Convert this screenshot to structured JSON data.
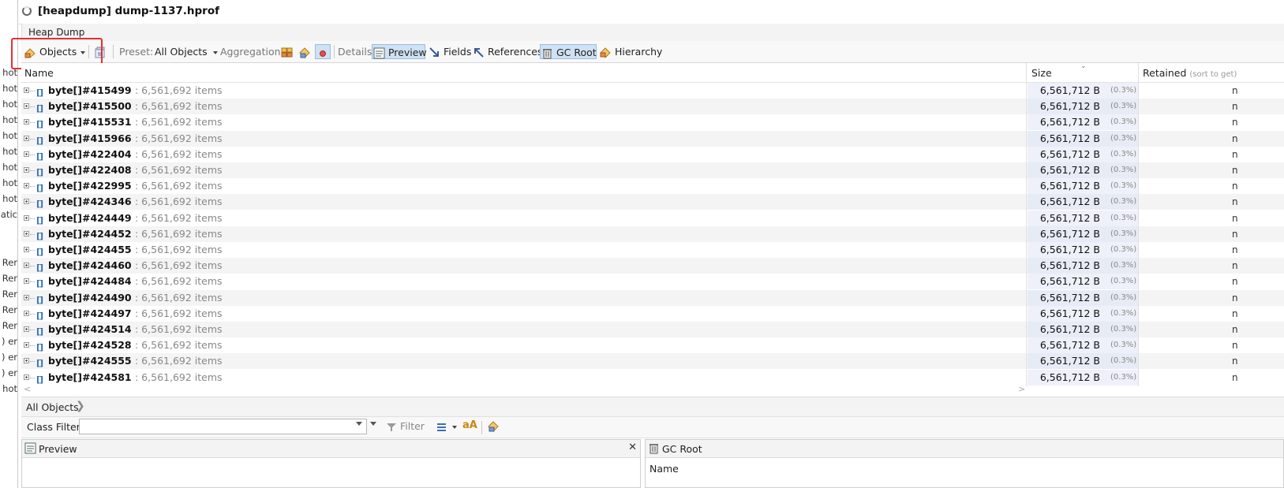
{
  "left_strip": [
    "hot",
    "hot",
    "hot",
    "hot",
    "hot",
    "hot",
    "hot",
    "hot",
    "hot",
    "atic",
    "",
    "",
    "",
    "Rer",
    "Rer",
    "Rer",
    "Rer",
    "Rer",
    "er (",
    "er (",
    "er (",
    "hot"
  ],
  "window": {
    "title": "[heapdump] dump-1137.hprof",
    "tab": "Heap Dump"
  },
  "toolbar": {
    "objects_label": "Objects",
    "preset_label": "Preset:",
    "preset_value": "All Objects",
    "aggregation_label": "Aggregation:",
    "details_label": "Details:",
    "preview_label": "Preview",
    "fields_label": "Fields",
    "references_label": "References",
    "gcroot_label": "GC Root",
    "hierarchy_label": "Hierarchy"
  },
  "table": {
    "col_name": "Name",
    "col_size": "Size",
    "col_retained": "Retained",
    "col_retained_hint": "(sort to get)",
    "rows": [
      {
        "name": "byte[]#415499",
        "items": ": 6,561,692 items",
        "size": "6,561,712 B",
        "pct": "(0.3%)",
        "ret": "n"
      },
      {
        "name": "byte[]#415500",
        "items": ": 6,561,692 items",
        "size": "6,561,712 B",
        "pct": "(0.3%)",
        "ret": "n"
      },
      {
        "name": "byte[]#415531",
        "items": ": 6,561,692 items",
        "size": "6,561,712 B",
        "pct": "(0.3%)",
        "ret": "n"
      },
      {
        "name": "byte[]#415966",
        "items": ": 6,561,692 items",
        "size": "6,561,712 B",
        "pct": "(0.3%)",
        "ret": "n"
      },
      {
        "name": "byte[]#422404",
        "items": ": 6,561,692 items",
        "size": "6,561,712 B",
        "pct": "(0.3%)",
        "ret": "n"
      },
      {
        "name": "byte[]#422408",
        "items": ": 6,561,692 items",
        "size": "6,561,712 B",
        "pct": "(0.3%)",
        "ret": "n"
      },
      {
        "name": "byte[]#422995",
        "items": ": 6,561,692 items",
        "size": "6,561,712 B",
        "pct": "(0.3%)",
        "ret": "n"
      },
      {
        "name": "byte[]#424346",
        "items": ": 6,561,692 items",
        "size": "6,561,712 B",
        "pct": "(0.3%)",
        "ret": "n"
      },
      {
        "name": "byte[]#424449",
        "items": ": 6,561,692 items",
        "size": "6,561,712 B",
        "pct": "(0.3%)",
        "ret": "n"
      },
      {
        "name": "byte[]#424452",
        "items": ": 6,561,692 items",
        "size": "6,561,712 B",
        "pct": "(0.3%)",
        "ret": "n"
      },
      {
        "name": "byte[]#424455",
        "items": ": 6,561,692 items",
        "size": "6,561,712 B",
        "pct": "(0.3%)",
        "ret": "n"
      },
      {
        "name": "byte[]#424460",
        "items": ": 6,561,692 items",
        "size": "6,561,712 B",
        "pct": "(0.3%)",
        "ret": "n"
      },
      {
        "name": "byte[]#424484",
        "items": ": 6,561,692 items",
        "size": "6,561,712 B",
        "pct": "(0.3%)",
        "ret": "n"
      },
      {
        "name": "byte[]#424490",
        "items": ": 6,561,692 items",
        "size": "6,561,712 B",
        "pct": "(0.3%)",
        "ret": "n"
      },
      {
        "name": "byte[]#424497",
        "items": ": 6,561,692 items",
        "size": "6,561,712 B",
        "pct": "(0.3%)",
        "ret": "n"
      },
      {
        "name": "byte[]#424514",
        "items": ": 6,561,692 items",
        "size": "6,561,712 B",
        "pct": "(0.3%)",
        "ret": "n"
      },
      {
        "name": "byte[]#424528",
        "items": ": 6,561,692 items",
        "size": "6,561,712 B",
        "pct": "(0.3%)",
        "ret": "n"
      },
      {
        "name": "byte[]#424555",
        "items": ": 6,561,692 items",
        "size": "6,561,712 B",
        "pct": "(0.3%)",
        "ret": "n"
      },
      {
        "name": "byte[]#424581",
        "items": ": 6,561,692 items",
        "size": "6,561,712 B",
        "pct": "(0.3%)",
        "ret": "n"
      }
    ]
  },
  "breadcrumb": {
    "label": "All Objects"
  },
  "filter": {
    "label": "Class Filter:",
    "value": "",
    "filter_button": "Filter"
  },
  "panels": {
    "preview_title": "Preview",
    "gcroot_title": "GC Root",
    "gcroot_name_header": "Name"
  },
  "colors": {
    "highlight_box": "#e53030",
    "toggle_bg": "#cfe2f3",
    "size_col_bg": "#eef1fa"
  }
}
